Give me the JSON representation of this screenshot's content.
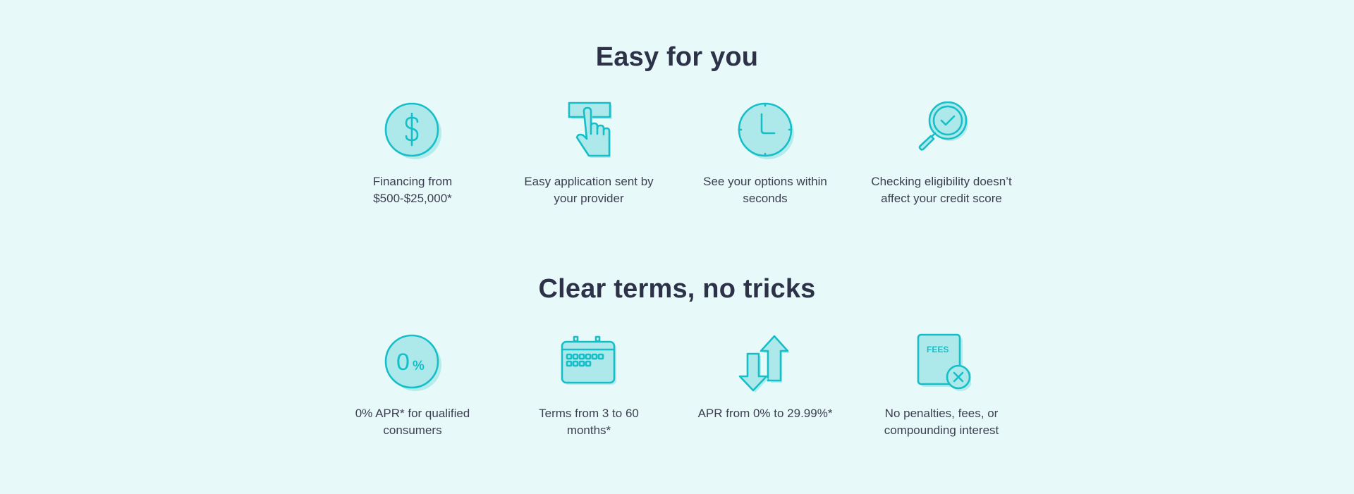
{
  "colors": {
    "background": "#e8f9f9",
    "heading": "#2d3249",
    "body_text": "#3b3f50",
    "icon_stroke": "#16bfc8",
    "icon_fill": "#ade9ea"
  },
  "sections": [
    {
      "title": "Easy for you",
      "features": [
        {
          "icon": "dollar-coin-icon",
          "line1": "Financing from",
          "line2": "$500-$25,000*"
        },
        {
          "icon": "hand-pointer-icon",
          "line1": "Easy application sent by",
          "line2": "your provider"
        },
        {
          "icon": "clock-icon",
          "line1": "See your options within",
          "line2": "seconds"
        },
        {
          "icon": "magnifier-check-icon",
          "line1": "Checking eligibility doesn’t",
          "line2": "affect your credit score"
        }
      ]
    },
    {
      "title": "Clear terms, no tricks",
      "features": [
        {
          "icon": "zero-percent-icon",
          "icon_text": "0",
          "icon_text_small": "%",
          "line1": "0% APR* for qualified",
          "line2": "consumers"
        },
        {
          "icon": "calendar-icon",
          "line1": "Terms from 3 to 60",
          "line2": "months*"
        },
        {
          "icon": "up-down-arrows-icon",
          "line1": "APR from 0% to 29.99%*",
          "line2": ""
        },
        {
          "icon": "no-fees-document-icon",
          "icon_text": "FEES",
          "line1": "No penalties, fees, or",
          "line2": "compounding interest"
        }
      ]
    }
  ]
}
